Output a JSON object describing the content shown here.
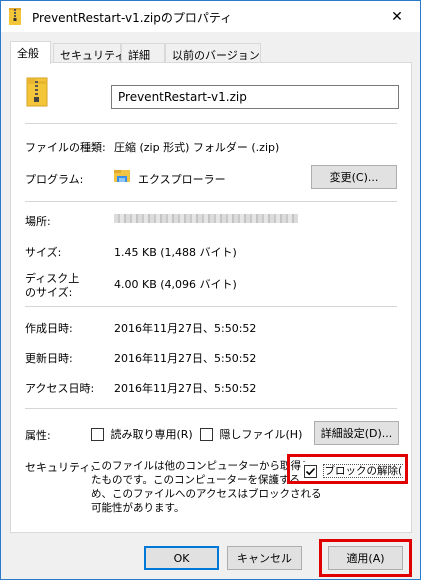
{
  "window": {
    "title": "PreventRestart-v1.zipのプロパティ",
    "close_glyph": "✕"
  },
  "tabs": [
    {
      "label": "全般",
      "active": true
    },
    {
      "label": "セキュリティ",
      "active": false
    },
    {
      "label": "詳細",
      "active": false
    },
    {
      "label": "以前のバージョン",
      "active": false
    }
  ],
  "general": {
    "file_name": "PreventRestart-v1.zip",
    "type_label": "ファイルの種類:",
    "type_value": "圧縮 (zip 形式) フォルダー (.zip)",
    "program_label": "プログラム:",
    "program_value": "エクスプローラー",
    "change_button": "変更(C)...",
    "location_label": "場所:",
    "size_label": "サイズ:",
    "size_value": "1.45 KB (1,488 バイト)",
    "disk_size_label_1": "ディスク上",
    "disk_size_label_2": "のサイズ:",
    "disk_size_value": "4.00 KB (4,096 バイト)",
    "created_label": "作成日時:",
    "created_value": "2016年11月27日、5:50:52",
    "modified_label": "更新日時:",
    "modified_value": "2016年11月27日、5:50:52",
    "accessed_label": "アクセス日時:",
    "accessed_value": "2016年11月27日、5:50:52",
    "attributes_label": "属性:",
    "readonly_label": "読み取り専用(R)",
    "hidden_label": "隠しファイル(H)",
    "advanced_button": "詳細設定(D)...",
    "security_label": "セキュリティ:",
    "security_text": [
      "このファイルは他のコンピューターから取得し",
      "たものです。このコンピューターを保護するた",
      "め、このファイルへのアクセスはブロックされる",
      "可能性があります。"
    ],
    "unblock_label": "ブロックの解除(K)",
    "unblock_checked": true
  },
  "footer": {
    "ok": "OK",
    "cancel": "キャンセル",
    "apply": "適用(A)"
  },
  "colors": {
    "highlight": "#e00000",
    "accent": "#0078d7"
  }
}
